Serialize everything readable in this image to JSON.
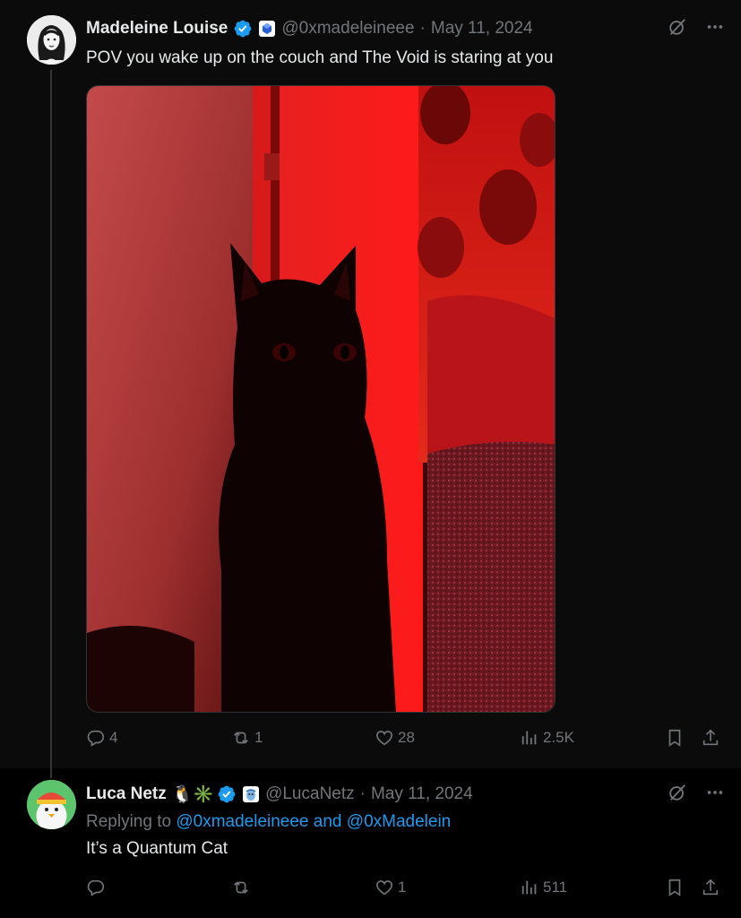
{
  "tweet": {
    "author_name": "Madeleine Louise",
    "handle": "@0xmadeleineee",
    "separator": "·",
    "date": "May 11, 2024",
    "text": "POV you wake up on the couch and The Void is staring at you",
    "stats": {
      "replies": "4",
      "retweets": "1",
      "likes": "28",
      "views": "2.5K"
    }
  },
  "reply": {
    "author_name": "Luca Netz",
    "emojis": "🐧✳️",
    "handle": "@LucaNetz",
    "separator": "·",
    "date": "May 11, 2024",
    "replying_prefix": "Replying to ",
    "replying_handle_1": "@0xmadeleineee",
    "replying_and": " and ",
    "replying_handle_2": "@0xMadelein",
    "text": "It’s a Quantum Cat",
    "stats": {
      "replies": "",
      "retweets": "",
      "likes": "1",
      "views": "511"
    }
  },
  "colors": {
    "background": "#000000",
    "tweet_background": "#0b0b0b",
    "text": "#e7e9ea",
    "muted": "#71767b",
    "link": "#1d9bf0",
    "verified": "#1d9bf0"
  },
  "icons": [
    "grok-icon",
    "more-icon",
    "reply-icon",
    "retweet-icon",
    "like-icon",
    "views-icon",
    "bookmark-icon",
    "share-icon",
    "verified-badge-icon",
    "affiliate-badge-icon"
  ]
}
